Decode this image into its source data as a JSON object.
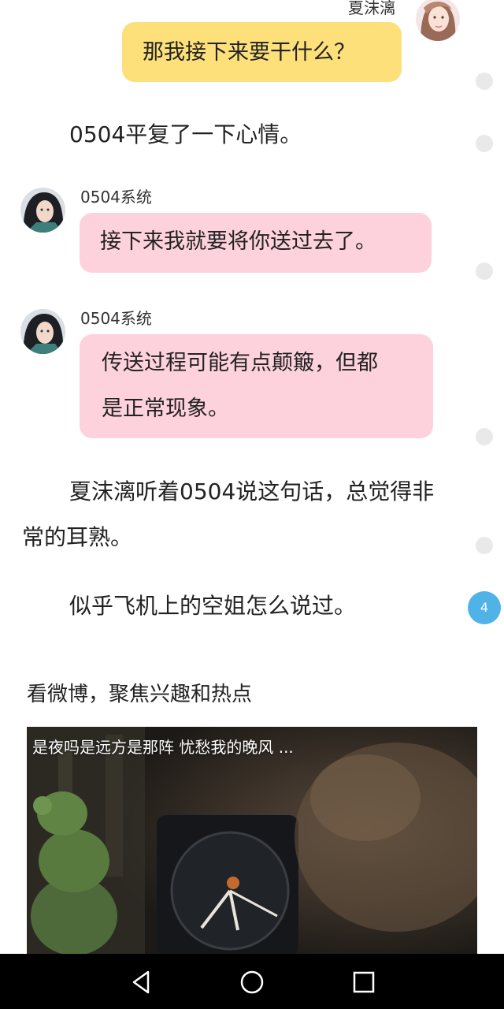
{
  "chat": {
    "messages": [
      {
        "speaker": "夏沫漓",
        "text": "那我接下来要干什么？"
      },
      {
        "speaker": "0504系统",
        "text": "接下来我就要将你送过去了。"
      },
      {
        "speaker": "0504系统",
        "text_line1": "传送过程可能有点颠簸，但都",
        "text_line2": "是正常现象。"
      }
    ]
  },
  "narration": {
    "p1": "0504平复了一下心情。",
    "p2_line1": "夏沫漓听着0504说这句话，总觉得非",
    "p2_line2": "常的耳熟。",
    "p3": "似乎飞机上的空姐怎么说过。"
  },
  "comment_badge": "4",
  "promo": {
    "title": "看微博，聚焦兴趣和热点",
    "video_caption": "是夜吗是远方是那阵 忧愁我的晚风 ..."
  },
  "colors": {
    "user_bubble": "#fde07a",
    "system_bubble": "#fdd2dc",
    "badge": "#4fb3e8"
  },
  "navbar": {
    "icons": [
      "back-triangle-icon",
      "home-circle-icon",
      "recents-square-icon"
    ]
  }
}
